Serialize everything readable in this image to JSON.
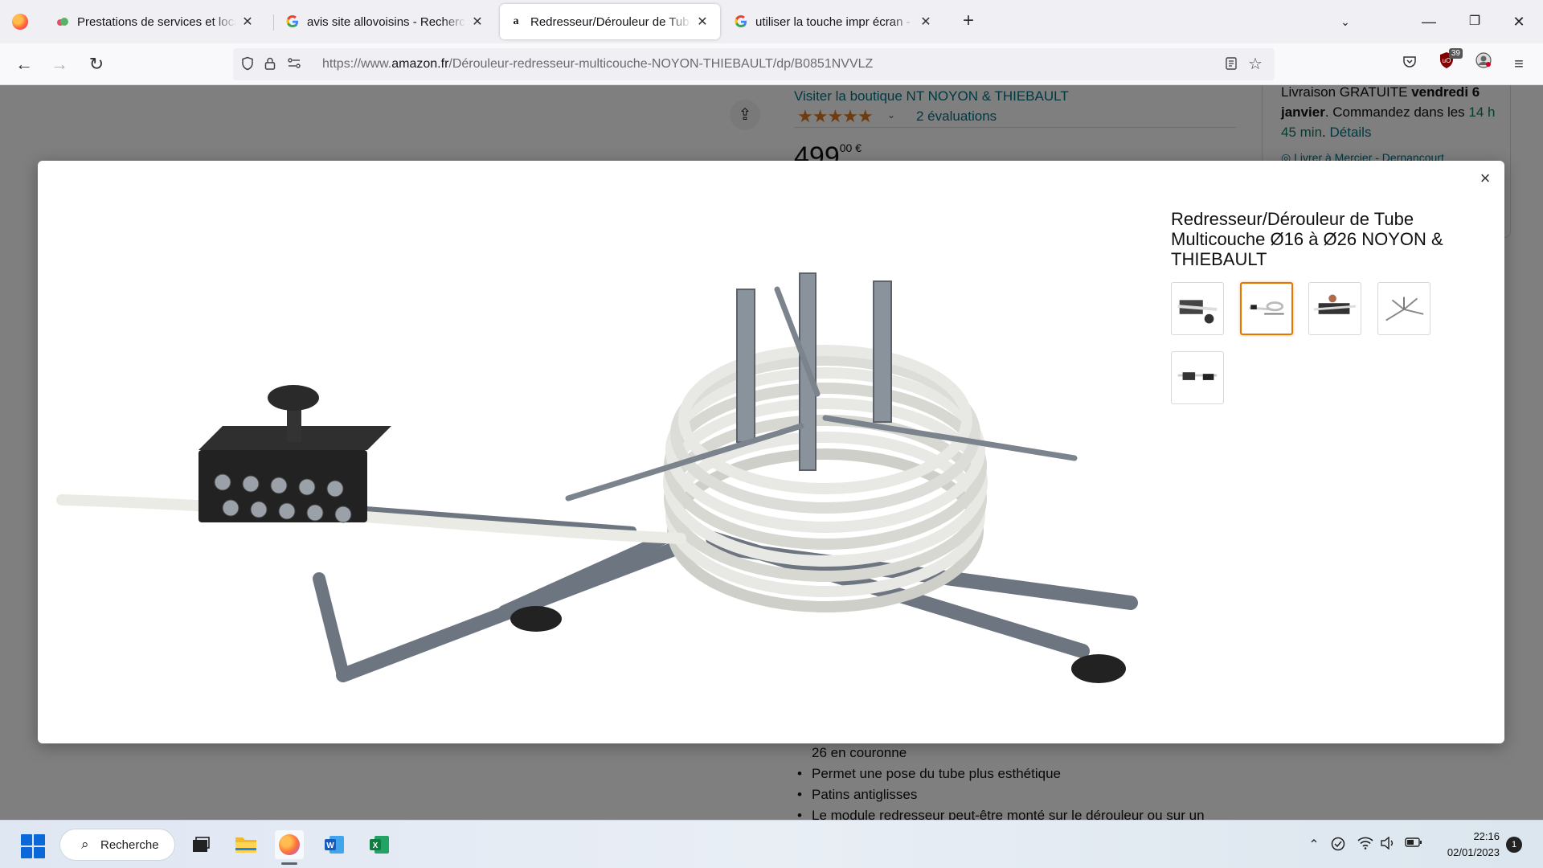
{
  "browser": {
    "tabs": [
      {
        "title": "Prestations de services et location",
        "favicon": "cloud-icon"
      },
      {
        "title": "avis site allovoisins - Recherche Google",
        "favicon": "google-icon"
      },
      {
        "title": "Redresseur/Dérouleur de Tube Multicouche",
        "favicon": "amazon-icon"
      },
      {
        "title": "utiliser la touche impr écran - Recherche",
        "favicon": "google-icon"
      }
    ],
    "active_tab": 2,
    "url_prefix": "https://www.",
    "url_domain": "amazon.fr",
    "url_path": "/Dérouleur-redresseur-multicouche-NOYON-THIEBAULT/dp/B0851NVVLZ",
    "extension_badge": "39"
  },
  "page": {
    "store_link": "Visiter la boutique NT NOYON & THIEBAULT",
    "stars": "★★★★★",
    "ratings": "2 évaluations",
    "price_main": "499",
    "price_cents": "00 €",
    "delivery_line1": "Livraison GRATUITE",
    "delivery_bold": "vendredi 6 janvier",
    "delivery_line2": ". Commandez dans les ",
    "delivery_time": "14 h 45 min",
    "delivery_details": "Détails",
    "deliver_to": "Livrer à Mercier - Dernancourt",
    "bullets": [
      "26 en couronne",
      "Permet une pose du tube plus esthétique",
      "Patins antiglisses",
      "Le module redresseur peut-être monté sur le dérouleur ou sur un"
    ]
  },
  "modal": {
    "close": "×",
    "title": "Redresseur/Dérouleur de Tube Multicouche Ø16 à Ø26 NOYON & THIEBAULT",
    "thumbnails_count": 5,
    "selected_thumbnail": 1
  },
  "taskbar": {
    "search_label": "Recherche",
    "time": "22:16",
    "date": "02/01/2023",
    "notifications": "1"
  },
  "colors": {
    "link": "#007185",
    "star": "#de7921",
    "selected_thumb": "#e77600",
    "green": "#067d62"
  }
}
